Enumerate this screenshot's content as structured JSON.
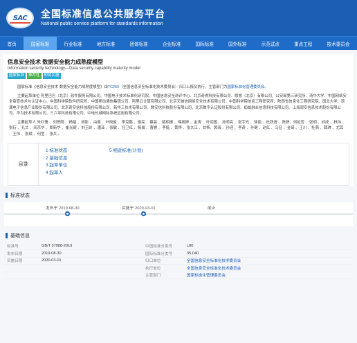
{
  "header": {
    "logo_text": "SAC",
    "title_cn": "全国标准信息公共服务平台",
    "title_en": "National public service platform  for standards information"
  },
  "nav": [
    "首页",
    "国家标准",
    "行业标准",
    "地方标准",
    "团体标准",
    "企业标准",
    "国际标准",
    "国外标准",
    "示范试点",
    "重点工程",
    "技术委员会"
  ],
  "nav_active_index": 1,
  "standard": {
    "title": "信息安全技术 数据安全能力成熟度模型",
    "subtitle": "Information security technology—Data security capability maturity model",
    "tags": [
      "国家标准",
      "推荐性",
      "即将实施"
    ]
  },
  "summary": {
    "p1_a": "国家标准《信息安全技术 数据安全能力成熟度模型》由",
    "p1_tc": "TC260",
    "p1_b": "（全国信息安全标准化技术委员会）归口上报及执行，主管部门为",
    "p1_dept": "国家标准化管理委员会",
    "p1_c": "。",
    "p2": "主要起草单位 阿里巴巴（北京）软件服务有限公司、中国电子技术标准化研究院、中国信息安全测评中心、北京奇虎科技有限公司、联想（北京）有限公司、公安部第三研究所、清华大学、中国网络安全审查技术与认证中心、中国科学院软件研究所、中国移动通信集团公司、阿里云计算有限公司、北京天融信网络安全技术有限公司、中国科学院信息工程研究所、陕西省信息化工程研究院、国北大学、浪潮电子信息产业股份有限公司、北京奇安信科技股份有限公司、新华三技术有限公司、数安信科技股份有限公司、北京数字认证股份有限公司、蚂蚁融合信息科技有限公司、上海观安信息技术股份有限公司、华为技术有限公司、三六零科技有限公司、中电长城网际系统应用有限公司。",
    "p3": "主要起草人 朱红儒 、刘贤刚 、杨韬 、胡影 、由睿 、叶晓俊 、李克鹏 、谢亮 、蔡晨 、姚相振 、梅婉婷 、金涛 、叶润国 、孙明亮 、张宇光 、徐丽 、杜跃进 、陈舒、何延哲 、张明 、邱成 、林炜 、张衍 、孔兰 、闵京华 、郑新华 、崔光耀 、刘玉岭 、潘亚 、张敏 、任卫红 、杨晨 、曹睿 、李挺 、黄铮 、张大江 、甘杨、黄海 、孙迎 、李奇 、孙健 、赵红 、马征 、金琦 、王川 、杜萌 、薛琪 、尤其 、王伟 、张斌 、何莹 、张兵 。"
  },
  "toc": {
    "label": "目录",
    "col1": [
      "1  标准状态",
      "2  基础信息",
      "3  起草单位",
      "4  起草人"
    ],
    "col2": [
      "5  相近标准(计划)"
    ]
  },
  "status_section": {
    "title": "标准状态",
    "publish_label": "发布于 2019-08-30",
    "implement_label": "实施于 2020-03-01",
    "abolish_label": "废止"
  },
  "basic_section": {
    "title": "基础信息",
    "rows": [
      {
        "k1": "标准号",
        "v1": "GB/T 37988-2019",
        "k2": "中国标准分类号",
        "v2": "L80",
        "link": false
      },
      {
        "k1": "发布日期",
        "v1": "2019-08-30",
        "k2": "国际标准分类号",
        "v2": "35.040",
        "link": false
      },
      {
        "k1": "实施日期",
        "v1": "2020-03-01",
        "k2": "归口单位",
        "v2": "全国信息安全标准化技术委员会",
        "link": true
      },
      {
        "k1": "",
        "v1": "",
        "k2": "执行单位",
        "v2": "全国信息安全标准化技术委员会",
        "link": true
      },
      {
        "k1": "",
        "v1": "",
        "k2": "主管部门",
        "v2": "国家标准化管理委员会",
        "link": true
      }
    ]
  },
  "colors": {
    "primary": "#1a5fb4",
    "nav_active": "#5aa5ee",
    "tag_national": "#2aa7c9",
    "tag_recommended": "#4cae4c",
    "tag_upcoming": "#28a9d6"
  }
}
